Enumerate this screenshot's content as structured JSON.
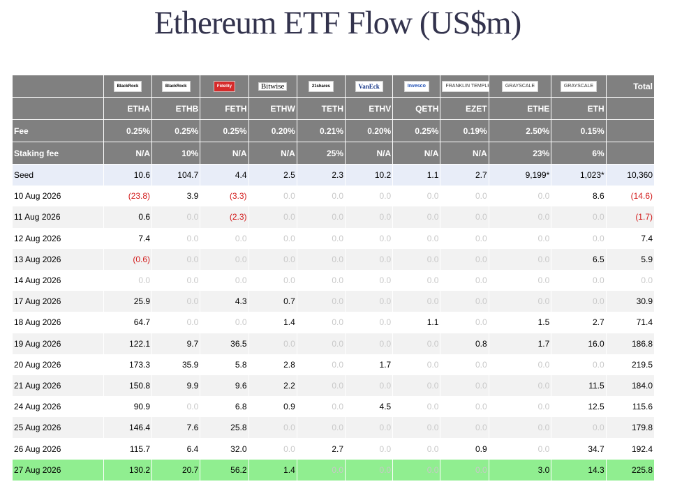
{
  "title": "Ethereum ETF Flow (US$m)",
  "columns": [
    {
      "issuer": "BlackRock",
      "ticker": "ETHA",
      "fee": "0.25%",
      "staking": "N/A",
      "logo": "blackrock-logo"
    },
    {
      "issuer": "BlackRock",
      "ticker": "ETHB",
      "fee": "0.25%",
      "staking": "10%",
      "logo": "blackrock-logo"
    },
    {
      "issuer": "Fidelity",
      "ticker": "FETH",
      "fee": "0.25%",
      "staking": "N/A",
      "logo": "fidelity-logo"
    },
    {
      "issuer": "Bitwise",
      "ticker": "ETHW",
      "fee": "0.20%",
      "staking": "N/A",
      "logo": "bitwise-logo"
    },
    {
      "issuer": "21shares",
      "ticker": "TETH",
      "fee": "0.21%",
      "staking": "25%",
      "logo": "21shares-logo"
    },
    {
      "issuer": "VanEck",
      "ticker": "ETHV",
      "fee": "0.20%",
      "staking": "N/A",
      "logo": "vaneck-logo"
    },
    {
      "issuer": "Invesco",
      "ticker": "QETH",
      "fee": "0.25%",
      "staking": "N/A",
      "logo": "invesco-logo"
    },
    {
      "issuer": "FRANKLIN TEMPLETON",
      "ticker": "EZET",
      "fee": "0.19%",
      "staking": "N/A",
      "logo": "franklin-logo"
    },
    {
      "issuer": "GRAYSCALE",
      "ticker": "ETHE",
      "fee": "2.50%",
      "staking": "23%",
      "logo": "grayscale-logo"
    },
    {
      "issuer": "GRAYSCALE",
      "ticker": "ETH",
      "fee": "0.15%",
      "staking": "6%",
      "logo": "grayscale-logo"
    }
  ],
  "labels": {
    "total": "Total",
    "fee": "Fee",
    "staking": "Staking fee"
  },
  "rows": [
    {
      "label": "Seed",
      "values": [
        "10.6",
        "104.7",
        "4.4",
        "2.5",
        "2.3",
        "10.2",
        "1.1",
        "2.7",
        "9,199*",
        "1,023*"
      ],
      "total": "10,360",
      "style": "seed"
    },
    {
      "label": "10 Aug 2026",
      "values": [
        "(23.8)",
        "3.9",
        "(3.3)",
        "0.0",
        "0.0",
        "0.0",
        "0.0",
        "0.0",
        "0.0",
        "8.6"
      ],
      "total": "(14.6)",
      "style": ""
    },
    {
      "label": "11 Aug 2026",
      "values": [
        "0.6",
        "0.0",
        "(2.3)",
        "0.0",
        "0.0",
        "0.0",
        "0.0",
        "0.0",
        "0.0",
        "0.0"
      ],
      "total": "(1.7)",
      "style": "alt"
    },
    {
      "label": "12 Aug 2026",
      "values": [
        "7.4",
        "0.0",
        "0.0",
        "0.0",
        "0.0",
        "0.0",
        "0.0",
        "0.0",
        "0.0",
        "0.0"
      ],
      "total": "7.4",
      "style": ""
    },
    {
      "label": "13 Aug 2026",
      "values": [
        "(0.6)",
        "0.0",
        "0.0",
        "0.0",
        "0.0",
        "0.0",
        "0.0",
        "0.0",
        "0.0",
        "6.5"
      ],
      "total": "5.9",
      "style": "alt"
    },
    {
      "label": "14 Aug 2026",
      "values": [
        "0.0",
        "0.0",
        "0.0",
        "0.0",
        "0.0",
        "0.0",
        "0.0",
        "0.0",
        "0.0",
        "0.0"
      ],
      "total": "0.0",
      "style": ""
    },
    {
      "label": "17 Aug 2026",
      "values": [
        "25.9",
        "0.0",
        "4.3",
        "0.7",
        "0.0",
        "0.0",
        "0.0",
        "0.0",
        "0.0",
        "0.0"
      ],
      "total": "30.9",
      "style": "alt"
    },
    {
      "label": "18 Aug 2026",
      "values": [
        "64.7",
        "0.0",
        "0.0",
        "1.4",
        "0.0",
        "0.0",
        "1.1",
        "0.0",
        "1.5",
        "2.7"
      ],
      "total": "71.4",
      "style": ""
    },
    {
      "label": "19 Aug 2026",
      "values": [
        "122.1",
        "9.7",
        "36.5",
        "0.0",
        "0.0",
        "0.0",
        "0.0",
        "0.8",
        "1.7",
        "16.0"
      ],
      "total": "186.8",
      "style": "alt"
    },
    {
      "label": "20 Aug 2026",
      "values": [
        "173.3",
        "35.9",
        "5.8",
        "2.8",
        "0.0",
        "1.7",
        "0.0",
        "0.0",
        "0.0",
        "0.0"
      ],
      "total": "219.5",
      "style": ""
    },
    {
      "label": "21 Aug 2026",
      "values": [
        "150.8",
        "9.9",
        "9.6",
        "2.2",
        "0.0",
        "0.0",
        "0.0",
        "0.0",
        "0.0",
        "11.5"
      ],
      "total": "184.0",
      "style": "alt"
    },
    {
      "label": "24 Aug 2026",
      "values": [
        "90.9",
        "0.0",
        "6.8",
        "0.9",
        "0.0",
        "4.5",
        "0.0",
        "0.0",
        "0.0",
        "12.5"
      ],
      "total": "115.6",
      "style": ""
    },
    {
      "label": "25 Aug 2026",
      "values": [
        "146.4",
        "7.6",
        "25.8",
        "0.0",
        "0.0",
        "0.0",
        "0.0",
        "0.0",
        "0.0",
        "0.0"
      ],
      "total": "179.8",
      "style": "alt"
    },
    {
      "label": "26 Aug 2026",
      "values": [
        "115.7",
        "6.4",
        "32.0",
        "0.0",
        "2.7",
        "0.0",
        "0.0",
        "0.9",
        "0.0",
        "34.7"
      ],
      "total": "192.4",
      "style": ""
    },
    {
      "label": "27 Aug 2026",
      "values": [
        "130.2",
        "20.7",
        "56.2",
        "1.4",
        "0.0",
        "0.0",
        "0.0",
        "0.0",
        "3.0",
        "14.3"
      ],
      "total": "225.8",
      "style": "last"
    }
  ],
  "colors": {
    "header_bg": "#808080",
    "negative": "#d21a1a",
    "zero": "#c8c8c8",
    "highlight": "#90ee90",
    "seed_bg": "#e8edf8"
  }
}
